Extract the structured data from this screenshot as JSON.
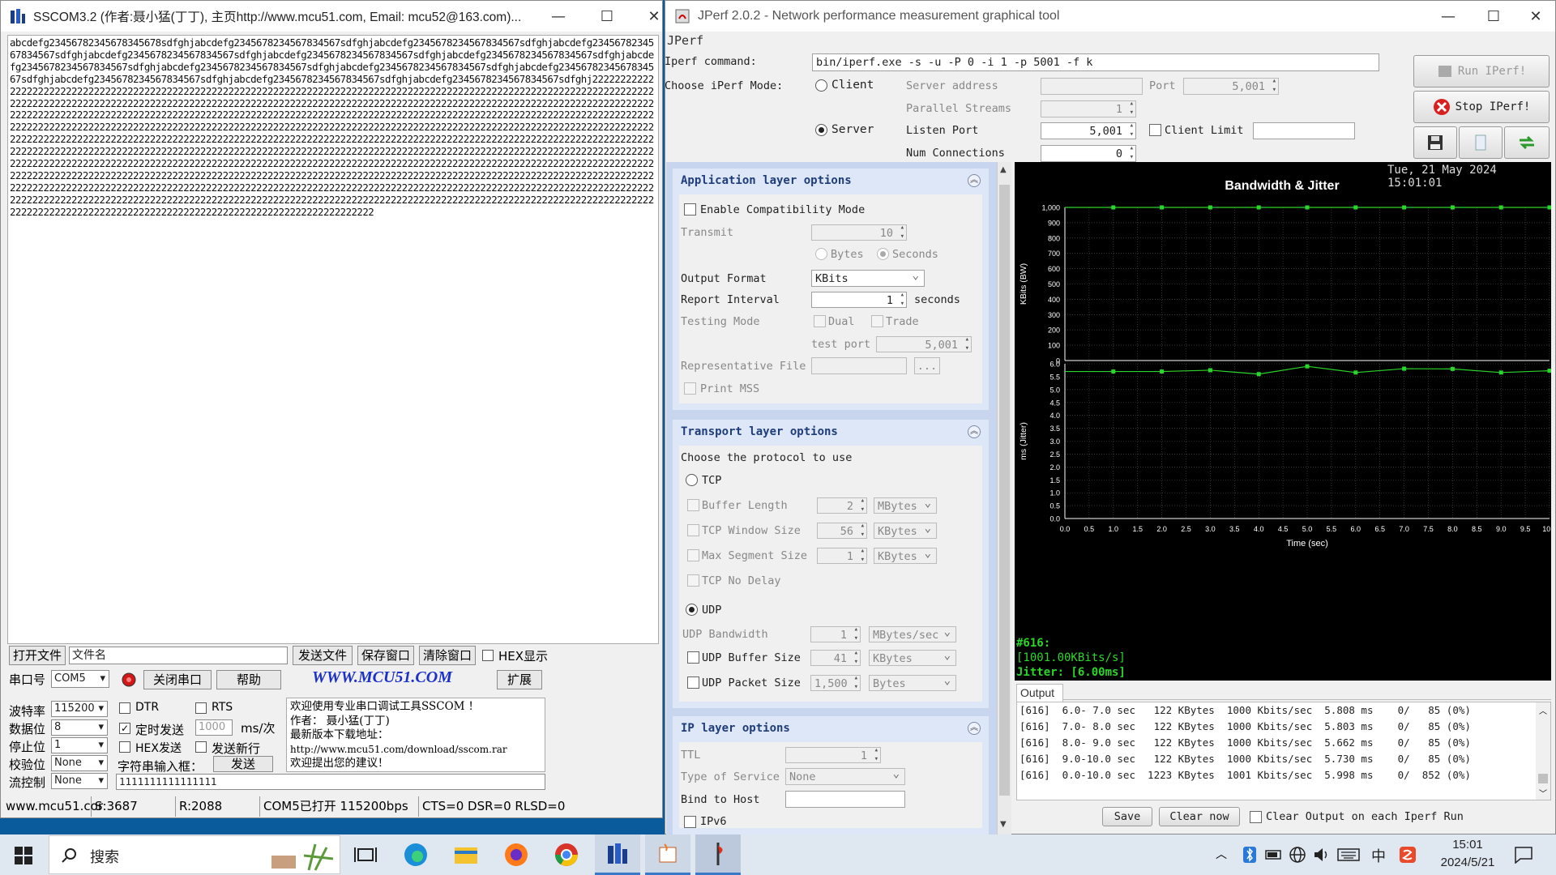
{
  "sscom": {
    "title": "SSCOM3.2 (作者:聂小猛(丁丁), 主页http://www.mcu51.com,  Email: mcu52@163.com)...",
    "receive_text": "abcdefg23456782345678345678sdfghjabcdefg2345678234567834567sdfghjabcdefg2345678234567834567sdfghjabcdefg2345678234567834567sdfghjabcdefg2345678234567834567sdfghjabcdefg2345678234567834567sdfghjabcdefg2345678234567834567sdfghjabcdefg2345678234567834567sdfghjabcdefg2345678234567834567sdfghjabcdefg2345678234567834567sdfghjabcdefg2345678234567834567sdfghjabcdefg2345678234567834567sdfghjabcdefg2345678234567834567sdfghjabcdefg2345678234567834567sdfghj22222222222222222222222222222222222222222222222222222222222222222222222222222222222222222222222222222222222222222222222222222222222222222222222222222222222222222222222222222222222222222222222222222222222222222222222222222222222222222222222222222222222222222222222222222222222222222222222222222222222222222222222222222222222222222222222222222222222222222222222222222222222222222222222222222222222222222222222222222222222222222222222222222222222222222222222222222222222222222222222222222222222222222222222222222222222222222222222222222222222222222222222222222222222222222222222222222222222222222222222222222222222222222222222222222222222222222222222222222222222222222222222222222222222222222222222222222222222222222222222222222222222222222222222222222222222222222222222222222222222222222222222222222222222222222222222222222222222222222222222222222222222222222222222222222222222222222222222222222222222222222222222222222222222222222222222222222222222222222222222222222222222222222222222222222222222222222222222222222222222222222222222222222222222222222222222222222222222222222222222222222222222222222222222222222222222222222222222222222222222222222222222222222222222222222222222222222222222222222222222222222222222222222222222222",
    "open_file": "打开文件",
    "file_name": "文件名",
    "send_file": "发送文件",
    "save_window": "保存窗口",
    "clear_window": "清除窗口",
    "hex_display": "HEX显示",
    "port_label": "串口号",
    "port_value": "COM5",
    "close_port": "关闭串口",
    "help": "帮助",
    "website": "WWW.MCU51.COM",
    "expand": "扩展",
    "baud_label": "波特率",
    "baud_value": "115200",
    "data_bits_label": "数据位",
    "data_bits_value": "8",
    "stop_bits_label": "停止位",
    "stop_bits_value": "1",
    "parity_label": "校验位",
    "parity_value": "None",
    "flow_label": "流控制",
    "flow_value": "None",
    "dtr": "DTR",
    "rts": "RTS",
    "timed_send": "定时发送",
    "interval_value": "1000",
    "interval_unit": "ms/次",
    "hex_send": "HEX发送",
    "send_newline": "发送新行",
    "string_input": "字符串输入框：",
    "send": "发送",
    "send_text": "1111111111111111",
    "info_lines": [
      "欢迎使用专业串口调试工具SSCOM ！",
      "作者： 聂小猛(丁丁)",
      "最新版本下载地址：",
      "http://www.mcu51.com/download/sscom.rar",
      "欢迎提出您的建议！"
    ],
    "status_site": "www.mcu51.cor",
    "status_s": "S:3687",
    "status_r": "R:2088",
    "status_port": "COM5已打开  115200bps",
    "status_lines": "CTS=0 DSR=0 RLSD=0"
  },
  "jperf": {
    "title": "JPerf 2.0.2 - Network performance measurement graphical tool",
    "menu": "JPerf",
    "command_label": "Iperf command:",
    "command_value": "bin/iperf.exe -s -u -P 0 -i 1 -p 5001 -f k",
    "mode_label": "Choose iPerf Mode:",
    "client": "Client",
    "server": "Server",
    "server_address": "Server address",
    "port_label": "Port",
    "port_value": "5,001",
    "parallel_streams": "Parallel Streams",
    "parallel_value": "1",
    "listen_port": "Listen Port",
    "listen_value": "5,001",
    "client_limit": "Client Limit",
    "num_connections": "Num Connections",
    "num_conn_value": "0",
    "run": "Run IPerf!",
    "stop": "Stop IPerf!",
    "app": {
      "title": "Application layer options",
      "compat": "Enable Compatibility Mode",
      "transmit": "Transmit",
      "transmit_value": "10",
      "bytes": "Bytes",
      "seconds": "Seconds",
      "output_format": "Output Format",
      "output_value": "KBits",
      "report_interval": "Report Interval",
      "report_value": "1",
      "report_unit": "seconds",
      "testing_mode": "Testing Mode",
      "dual": "Dual",
      "trade": "Trade",
      "test_port": "test port",
      "test_port_value": "5,001",
      "rep_file": "Representative File",
      "browse": "...",
      "print_mss": "Print MSS"
    },
    "transport": {
      "title": "Transport layer options",
      "choose": "Choose the protocol to use",
      "tcp": "TCP",
      "buffer_length": "Buffer Length",
      "buffer_value": "2",
      "buffer_unit": "MBytes",
      "window_size": "TCP Window Size",
      "window_value": "56",
      "window_unit": "KBytes",
      "max_seg": "Max Segment Size",
      "max_seg_value": "1",
      "max_seg_unit": "KBytes",
      "no_delay": "TCP No Delay",
      "udp": "UDP",
      "udp_bw": "UDP Bandwidth",
      "udp_bw_value": "1",
      "udp_bw_unit": "MBytes/sec",
      "udp_buf": "UDP Buffer Size",
      "udp_buf_value": "41",
      "udp_buf_unit": "KBytes",
      "udp_pkt": "UDP Packet Size",
      "udp_pkt_value": "1,500",
      "udp_pkt_unit": "Bytes"
    },
    "ip": {
      "title": "IP layer options",
      "ttl": "TTL",
      "ttl_value": "1",
      "tos": "Type of Service",
      "tos_value": "None",
      "bind": "Bind to Host",
      "ipv6": "IPv6"
    },
    "timestamp": "Tue, 21 May 2024 15:01:01",
    "stats": [
      "#616:",
      "[1001.00KBits/s]",
      "Jitter: [6.00ms]"
    ],
    "output_tab": "Output",
    "output_lines": [
      "[616]  6.0- 7.0 sec   122 KBytes  1000 Kbits/sec  5.808 ms    0/   85 (0%)",
      "[616]  7.0- 8.0 sec   122 KBytes  1000 Kbits/sec  5.803 ms    0/   85 (0%)",
      "[616]  8.0- 9.0 sec   122 KBytes  1000 Kbits/sec  5.662 ms    0/   85 (0%)",
      "[616]  9.0-10.0 sec   122 KBytes  1000 Kbits/sec  5.730 ms    0/   85 (0%)",
      "[616]  0.0-10.0 sec  1223 KBytes  1001 Kbits/sec  5.998 ms    0/  852 (0%)"
    ],
    "save": "Save",
    "clear_now": "Clear now",
    "clear_each": "Clear Output on each Iperf Run"
  },
  "chart_data": [
    {
      "type": "line",
      "title": "Bandwidth & Jitter",
      "xlabel": "",
      "ylabel": "KBits (BW)",
      "x": [
        1,
        2,
        3,
        4,
        5,
        6,
        7,
        8,
        9,
        10
      ],
      "ylim": [
        0,
        1000
      ],
      "yticks": [
        "0",
        "100",
        "200",
        "300",
        "400",
        "500",
        "600",
        "700",
        "800",
        "900",
        "1,000"
      ],
      "series": [
        {
          "values": [
            1000,
            1000,
            1000,
            1000,
            1000,
            1000,
            1000,
            1000,
            1000,
            1000
          ],
          "color": "#2bd62b"
        }
      ]
    },
    {
      "type": "line",
      "xlabel": "Time (sec)",
      "ylabel": "ms (Jitter)",
      "x": [
        1,
        2,
        3,
        4,
        5,
        6,
        7,
        8,
        9,
        10
      ],
      "xlim": [
        0,
        10
      ],
      "xticks": [
        "0.0",
        "0.5",
        "1.0",
        "1.5",
        "2.0",
        "2.5",
        "3.0",
        "3.5",
        "4.0",
        "4.5",
        "5.0",
        "5.5",
        "6.0",
        "6.5",
        "7.0",
        "7.5",
        "8.0",
        "8.5",
        "9.0",
        "9.5",
        "10.0"
      ],
      "ylim": [
        0,
        6
      ],
      "yticks": [
        "0.0",
        "0.5",
        "1.0",
        "1.5",
        "2.0",
        "2.5",
        "3.0",
        "3.5",
        "4.0",
        "4.5",
        "5.0",
        "5.5",
        "6.0"
      ],
      "series": [
        {
          "values": [
            5.7,
            5.7,
            5.75,
            5.6,
            5.9,
            5.66,
            5.81,
            5.8,
            5.66,
            5.73
          ],
          "color": "#2bd62b"
        }
      ]
    }
  ],
  "taskbar": {
    "search": "搜索",
    "time": "15:01",
    "date": "2024/5/21",
    "ime": "中"
  }
}
